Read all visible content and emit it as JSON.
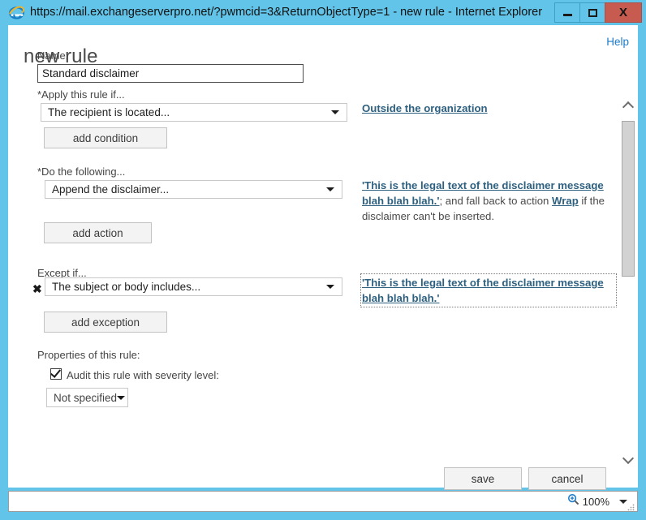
{
  "window": {
    "title": "https://mail.exchangeserverpro.net/?pwmcid=3&ReturnObjectType=1 - new rule - Internet Explorer",
    "app_icon": "internet-explorer-icon",
    "minimize_label": "–",
    "maximize_label": "□",
    "close_label": "X"
  },
  "page": {
    "help_label": "Help",
    "title": "new rule"
  },
  "form": {
    "name_label": "Name:",
    "name_value": "Standard disclaimer",
    "apply_label": "*Apply this rule if...",
    "condition_value": "The recipient is located...",
    "add_condition_label": "add condition",
    "condition_link": "Outside the organization",
    "do_label": "*Do the following...",
    "action_value": "Append the disclaimer...",
    "add_action_label": "add action",
    "action_link_1": "'This is the legal text of the disclaimer message blah blah blah.'",
    "action_text_mid": "; and fall back to action ",
    "action_link_2": "Wrap",
    "action_text_end": " if the disclaimer can't be inserted.",
    "except_label": "Except if...",
    "exception_value": "The subject or body includes...",
    "delete_exception_icon": "✖",
    "add_exception_label": "add exception",
    "exception_link": "'This is the legal text of the disclaimer message blah blah blah.'",
    "properties_label": "Properties of this rule:",
    "audit_checkbox_label": "Audit this rule with severity level:",
    "audit_checked": true,
    "severity_value": "Not specified"
  },
  "footer": {
    "save_label": "save",
    "cancel_label": "cancel"
  },
  "statusbar": {
    "zoom_icon": "magnifier-icon",
    "zoom_level": "100%"
  },
  "colors": {
    "titlebar": "#62c4e8",
    "close_button": "#c75b4f",
    "help_link": "#1e7bc9",
    "content_link": "#2e6080"
  }
}
